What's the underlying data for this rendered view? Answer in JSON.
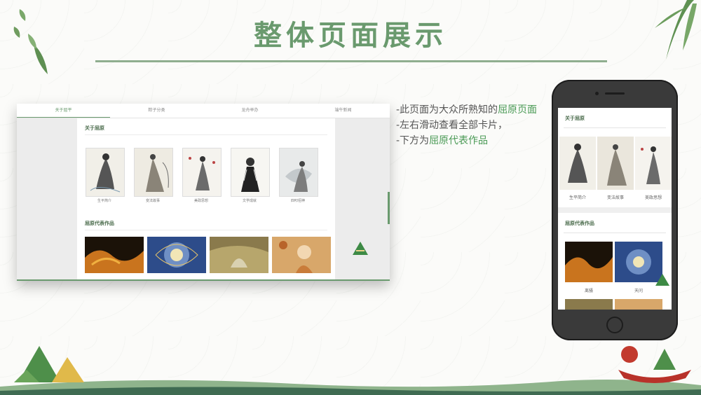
{
  "title": "整体页面展示",
  "desktop": {
    "tabs": [
      "关于屈平",
      "粽子分类",
      "龙舟举办",
      "端午新闻"
    ],
    "active_tab": 0,
    "section1_title": "关于屈原",
    "cards": [
      {
        "caption": "生平简介"
      },
      {
        "caption": "变法故事"
      },
      {
        "caption": "美政思想"
      },
      {
        "caption": "文学成就"
      },
      {
        "caption": "四叩招神"
      }
    ],
    "section2_title": "屈原代表作品"
  },
  "bullets": [
    {
      "pre": "-此页面为大众所熟知的",
      "hl": "屈原页面"
    },
    {
      "pre": "-左右滑动查看全部卡片，",
      "hl": ""
    },
    {
      "pre": "-下方为",
      "hl": "屈原代表作品"
    }
  ],
  "phone": {
    "section1_title": "关于屈原",
    "cards": [
      {
        "caption": "生平简介"
      },
      {
        "caption": "变法故事"
      },
      {
        "caption": "美政思想"
      }
    ],
    "section2_title": "屈原代表作品",
    "works": [
      {
        "caption": "离骚"
      },
      {
        "caption": "天问"
      },
      {
        "caption": ""
      },
      {
        "caption": ""
      }
    ]
  },
  "colors": {
    "accent": "#6a9a6e",
    "highlight": "#4a9a55"
  }
}
